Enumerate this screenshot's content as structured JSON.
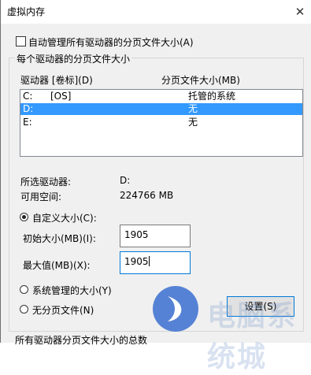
{
  "window": {
    "title": "虚拟内存",
    "close_glyph": "✕"
  },
  "auto_manage": {
    "label": "自动管理所有驱动器的分页文件大小(A)",
    "checked": false
  },
  "group": {
    "title": "每个驱动器的分页文件大小",
    "col_drive": "驱动器 [卷标](D)",
    "col_size": "分页文件大小(MB)",
    "rows": [
      {
        "drive": "C:",
        "label": "[OS]",
        "size": "托管的系统",
        "selected": false
      },
      {
        "drive": "D:",
        "label": "",
        "size": "无",
        "selected": true
      },
      {
        "drive": "E:",
        "label": "",
        "size": "无",
        "selected": false
      }
    ],
    "selected_drive_label": "所选驱动器:",
    "selected_drive_value": "D:",
    "free_space_label": "可用空间:",
    "free_space_value": "224766 MB",
    "custom_size_label": "自定义大小(C):",
    "initial_size_label": "初始大小(MB)(I):",
    "initial_size_value": "1905",
    "max_size_label": "最大值(MB)(X):",
    "max_size_value": "1905",
    "system_managed_label": "系统管理的大小(Y)",
    "no_paging_label": "无分页文件(N)",
    "set_button_label": "设置(S)"
  },
  "total_section": {
    "title": "所有驱动器分页文件大小的总数"
  },
  "watermark": {
    "text": "电脑系统城",
    "accent": "#3b6fd0"
  },
  "colors": {
    "selection": "#3399ff",
    "focus_border": "#0078d7"
  }
}
